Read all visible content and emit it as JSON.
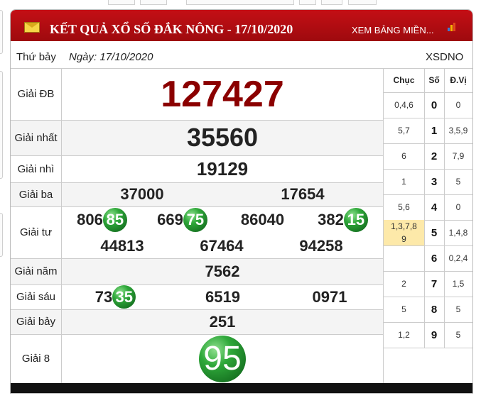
{
  "header": {
    "title": "KẾT QUẢ XỔ SỐ ĐẮK NÔNG - 17/10/2020",
    "more_link": "XEM BẢNG MIỀN...",
    "mail_icon": "envelope-icon",
    "feed_icon": "bar-chart-icon"
  },
  "info": {
    "weekday": "Thứ bảy",
    "date": "Ngày: 17/10/2020",
    "code": "XSDNO"
  },
  "prizes": {
    "db": {
      "label": "Giải ĐB",
      "value": "127427"
    },
    "nhat": {
      "label": "Giải nhất",
      "value": "35560"
    },
    "nhi": {
      "label": "Giải nhì",
      "value": "19129"
    },
    "ba": {
      "label": "Giải ba",
      "values": [
        "37000",
        "17654"
      ]
    },
    "tu": {
      "label": "Giải tư",
      "row1": [
        {
          "head": "806",
          "tail": "85"
        },
        {
          "head": "669",
          "tail": "75"
        },
        {
          "head": "86040",
          "tail": ""
        },
        {
          "head": "382",
          "tail": "15"
        }
      ],
      "row2": [
        "44813",
        "67464",
        "94258"
      ]
    },
    "nam": {
      "label": "Giải năm",
      "value": "7562"
    },
    "sau": {
      "label": "Giải sáu",
      "values": [
        {
          "head": "73",
          "tail": "35"
        },
        {
          "head": "6519",
          "tail": ""
        },
        {
          "head": "0971",
          "tail": ""
        }
      ]
    },
    "bay": {
      "label": "Giải bảy",
      "value": "251"
    },
    "tam": {
      "label": "Giải 8",
      "value": "95"
    }
  },
  "stats": {
    "headers": {
      "chuc": "Chục",
      "so": "Số",
      "dvi": "Đ.Vị"
    },
    "rows": [
      {
        "chuc": "0,4,6",
        "so": "0",
        "dvi": "0"
      },
      {
        "chuc": "5,7",
        "so": "1",
        "dvi": "3,5,9"
      },
      {
        "chuc": "6",
        "so": "2",
        "dvi": "7,9"
      },
      {
        "chuc": "1",
        "so": "3",
        "dvi": "5"
      },
      {
        "chuc": "5,6",
        "so": "4",
        "dvi": "0"
      },
      {
        "chuc": "1,3,7,8\n9",
        "so": "5",
        "dvi": "1,4,8"
      },
      {
        "chuc": "",
        "so": "6",
        "dvi": "0,2,4"
      },
      {
        "chuc": "2",
        "so": "7",
        "dvi": "1,5"
      },
      {
        "chuc": "5",
        "so": "8",
        "dvi": "5"
      },
      {
        "chuc": "1,2",
        "so": "9",
        "dvi": "5"
      }
    ],
    "highlight_color": "#fde9a9"
  },
  "colors": {
    "header_red": "#b40d12",
    "db_red": "#8b0000",
    "ball_green": "#1f8f2d",
    "row_alt": "#f4f4f4"
  }
}
